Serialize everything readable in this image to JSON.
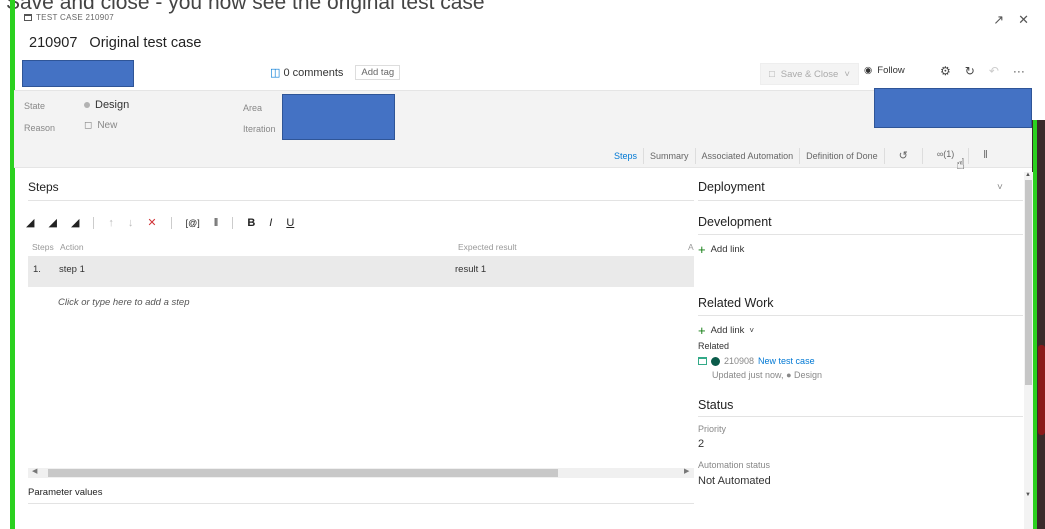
{
  "caption": "Save and close - you now see the original test case",
  "header": {
    "type_label": "TEST CASE 210907",
    "id": "210907",
    "title": "Original test case",
    "minimize_icon": "collapse-icon",
    "close_icon": "close-icon"
  },
  "toolbar": {
    "comments": "0 comments",
    "add_tag": "Add tag",
    "save_close": "Save & Close",
    "follow": "Follow",
    "more": "···"
  },
  "fields": {
    "state_label": "State",
    "state_value": "Design",
    "reason_label": "Reason",
    "reason_value": "New",
    "area_label": "Area",
    "iteration_label": "Iteration"
  },
  "tabs": [
    {
      "label": "Steps"
    },
    {
      "label": "Summary"
    },
    {
      "label": "Associated Automation"
    },
    {
      "label": "Definition of Done"
    }
  ],
  "links_tab": "(1)",
  "steps": {
    "title": "Steps",
    "col_steps": "Steps",
    "col_action": "Action",
    "col_expected": "Expected result",
    "col_attach": "A",
    "rows": [
      {
        "num": "1.",
        "action": "step 1",
        "expected": "result 1"
      }
    ],
    "add_placeholder": "Click or type here to add a step",
    "parameter_values": "Parameter values"
  },
  "side": {
    "deployment": "Deployment",
    "development": "Development",
    "dev_add_link": "Add link",
    "related_work": "Related Work",
    "rw_add_link": "Add link",
    "related_label": "Related",
    "related_item_id": "210908",
    "related_item_title": "New test case",
    "related_item_meta": "Updated just now,",
    "related_item_state": "Design",
    "status": "Status",
    "priority_label": "Priority",
    "priority_value": "2",
    "automation_label": "Automation status",
    "automation_value": "Not Automated"
  }
}
